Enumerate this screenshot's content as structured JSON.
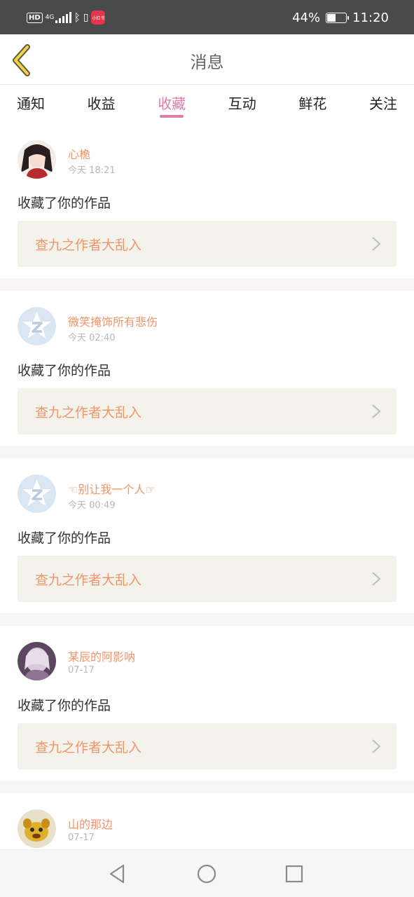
{
  "status_bar": {
    "hd": "HD",
    "network": "4G",
    "battery_text": "44%",
    "battery_level": 0.44,
    "time": "11:20",
    "notif_app_label": "小红书"
  },
  "header": {
    "title": "消息",
    "back_icon": "chevron-left-icon"
  },
  "tabs": [
    {
      "label": "通知",
      "active": false
    },
    {
      "label": "收益",
      "active": false
    },
    {
      "label": "收藏",
      "active": true
    },
    {
      "label": "互动",
      "active": false
    },
    {
      "label": "鲜花",
      "active": false
    },
    {
      "label": "关注",
      "active": false
    }
  ],
  "messages": [
    {
      "user": "心桅",
      "time": "今天 18:21",
      "text": "收藏了你的作品",
      "work": "查九之作者大乱入",
      "avatar": "anime-girl-avatar"
    },
    {
      "user": "微笑掩饰所有悲伤",
      "time": "今天 02:40",
      "text": "收藏了你的作品",
      "work": "查九之作者大乱入",
      "avatar": "default-star-avatar"
    },
    {
      "user": "☜别让我一个人☞",
      "time": "今天 00:49",
      "text": "收藏了你的作品",
      "work": "查九之作者大乱入",
      "avatar": "default-star-avatar"
    },
    {
      "user": "某辰的阿影呐",
      "time": "07-17",
      "text": "收藏了你的作品",
      "work": "查九之作者大乱入",
      "avatar": "purple-illustration-avatar"
    },
    {
      "user": "山的那边",
      "time": "07-17",
      "avatar": "cartoon-animal-avatar"
    }
  ],
  "colors": {
    "accent": "#e07bab",
    "username": "#f0956a",
    "link_bg": "#f3f3ec"
  },
  "bottom_nav": [
    "back-triangle-icon",
    "home-circle-icon",
    "recents-square-icon"
  ]
}
